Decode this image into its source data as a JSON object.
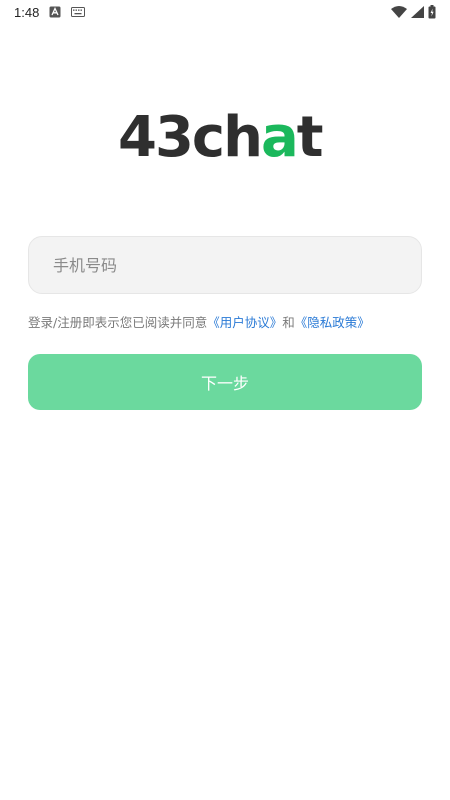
{
  "status_bar": {
    "time": "1:48",
    "icons": [
      "a-notification-icon",
      "keyboard-icon",
      "wifi-icon",
      "signal-icon",
      "battery-icon"
    ]
  },
  "logo": {
    "text_prefix": "43ch",
    "text_a": "a",
    "text_suffix": "t"
  },
  "phone_input": {
    "placeholder": "手机号码",
    "value": ""
  },
  "agreement": {
    "prefix": "登录/注册即表示您已阅读并同意",
    "user_agreement": "《用户协议》",
    "and": "和",
    "privacy_policy": "《隐私政策》"
  },
  "next_button": {
    "label": "下一步"
  },
  "colors": {
    "brand_green": "#1bb85c",
    "button_green": "#6bd99e",
    "link_blue": "#2a7ad6"
  }
}
